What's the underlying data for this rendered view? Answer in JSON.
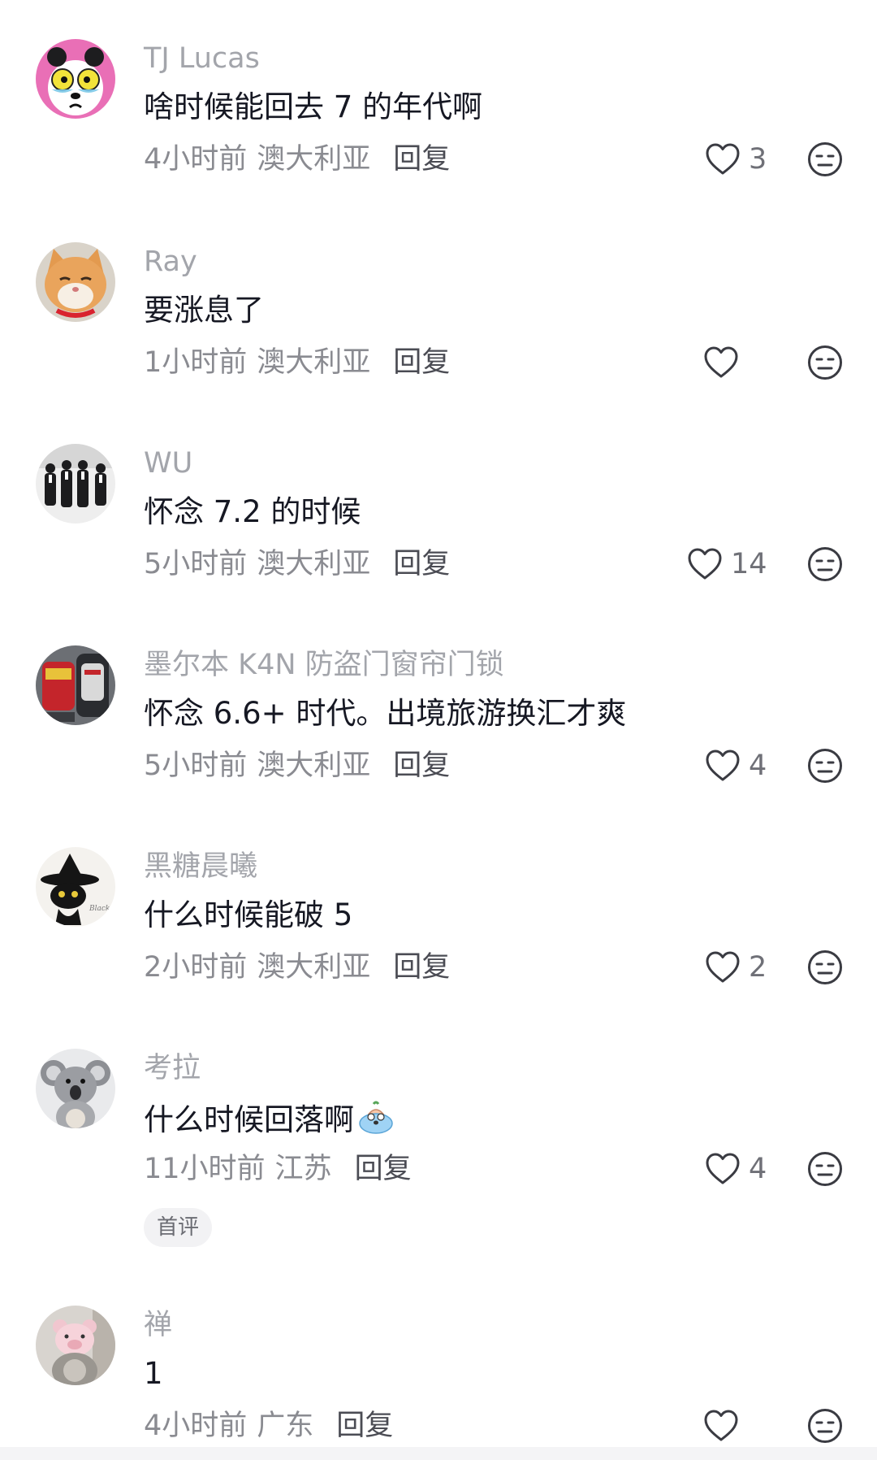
{
  "comments": [
    {
      "username": "TJ Lucas",
      "text": "啥时候能回去 7 的年代啊",
      "time": "4小时前",
      "region": "澳大利亚",
      "reply_label": "回复",
      "likes": "3",
      "avatar_icon": "panda-cartoon-avatar"
    },
    {
      "username": "Ray",
      "text": "要涨息了",
      "time": "1小时前",
      "region": "澳大利亚",
      "reply_label": "回复",
      "likes": "",
      "avatar_icon": "orange-cat-avatar"
    },
    {
      "username": "WU",
      "text": "怀念 7.2 的时候",
      "time": "5小时前",
      "region": "澳大利亚",
      "reply_label": "回复",
      "likes": "14",
      "avatar_icon": "group-in-suits-avatar"
    },
    {
      "username": "墨尔本 K4N 防盗门窗帘门锁",
      "text": "怀念 6.6+ 时代。出境旅游换汇才爽",
      "time": "5小时前",
      "region": "澳大利亚",
      "reply_label": "回复",
      "likes": "4",
      "avatar_icon": "power-tool-avatar"
    },
    {
      "username": "黑糖晨曦",
      "text": "什么时候能破 5",
      "time": "2小时前",
      "region": "澳大利亚",
      "reply_label": "回复",
      "likes": "2",
      "avatar_icon": "black-cat-witch-hat-avatar"
    },
    {
      "username": "考拉",
      "text": "什么时候回落啊",
      "time": "11小时前",
      "region": "江苏",
      "reply_label": "回复",
      "likes": "4",
      "badge": "首评",
      "avatar_icon": "koala-avatar",
      "emoji_icon": "crying-emoji"
    },
    {
      "username": "禅",
      "text": "1",
      "time": "4小时前",
      "region": "广东",
      "reply_label": "回复",
      "likes": "",
      "avatar_icon": "piglet-toy-avatar"
    }
  ],
  "colors": {
    "username": "#a3a5ab",
    "text": "#161823",
    "meta": "#8a8b91",
    "reply": "#4b4c54",
    "icon_stroke": "#3a3b42",
    "badge_bg": "#f2f2f4"
  }
}
